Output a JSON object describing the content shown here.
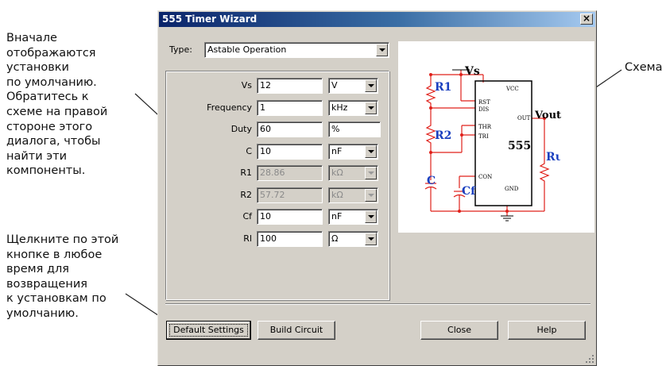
{
  "annotations": {
    "left_note": [
      "Вначале",
      "отображаются",
      "установки",
      "по умолчанию.",
      "Обратитесь к",
      "схеме на правой",
      "стороне этого",
      "диалога, чтобы",
      "найти эти",
      "компоненты."
    ],
    "bottom_note": [
      "Щелкните по этой",
      "кнопке в любое",
      "время для",
      "возвращения",
      "к установкам по",
      "умолчанию."
    ],
    "right_note": "Схема"
  },
  "dialog": {
    "title": "555 Timer Wizard",
    "close_glyph": "×",
    "type_label": "Type:",
    "type_value": "Astable Operation",
    "fields": [
      {
        "label": "Vs",
        "value": "12",
        "unit": "V",
        "enabled": true,
        "unit_combo": true
      },
      {
        "label": "Frequency",
        "value": "1",
        "unit": "kHz",
        "enabled": true,
        "unit_combo": true
      },
      {
        "label": "Duty",
        "value": "60",
        "unit": "%",
        "enabled": true,
        "unit_combo": false
      },
      {
        "label": "C",
        "value": "10",
        "unit": "nF",
        "enabled": true,
        "unit_combo": true
      },
      {
        "label": "R1",
        "value": "28.86",
        "unit": "kΩ",
        "enabled": false,
        "unit_combo": true
      },
      {
        "label": "R2",
        "value": "57.72",
        "unit": "kΩ",
        "enabled": false,
        "unit_combo": true
      },
      {
        "label": "Cf",
        "value": "10",
        "unit": "nF",
        "enabled": true,
        "unit_combo": true
      },
      {
        "label": "Rl",
        "value": "100",
        "unit": "Ω",
        "enabled": true,
        "unit_combo": true
      }
    ],
    "buttons": {
      "default_settings": "Default Settings",
      "build_circuit": "Build Circuit",
      "close": "Close",
      "help": "Help"
    }
  },
  "schematic": {
    "vs": "Vs",
    "vout": "Vout",
    "chip": "555",
    "r1": "R1",
    "r2": "R2",
    "c": "C",
    "cf": "Cf",
    "rl": "Rι",
    "pins": {
      "vcc": "VCC",
      "rst": "RST",
      "dis": "DIS",
      "thr": "THR",
      "tri": "TRI",
      "con": "CON",
      "out": "OUT",
      "gnd": "GND"
    },
    "colors": {
      "wire": "#e0201a",
      "label": "#1a3fbf",
      "chip": "#000000"
    }
  }
}
